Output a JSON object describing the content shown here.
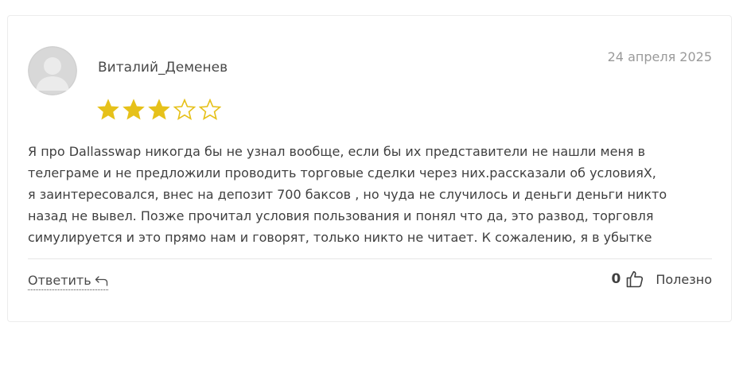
{
  "review": {
    "author": "Виталий_Деменев",
    "date": "24 апреля 2025",
    "rating": 3,
    "rating_max": 5,
    "avatar_icon": "user-avatar-placeholder-icon",
    "text_lines": [
      "Я про Dallasswap никогда бы не узнал вообще, если бы их представители не нашли меня в",
      "телеграме и не предложили проводить торговые сделки через них.рассказали об условияХ,",
      "я заинтересовался, внес на депозит 700 баксов , но чуда не случилось и деньги деньги никто",
      "назад не вывел. Позже прочитал условия пользования и понял что да, это развод, торговля",
      "симулируется и это прямо нам и говорят, только никто не читает. К сожалению, я в убытке"
    ]
  },
  "actions": {
    "reply_label": "Ответить",
    "reply_icon": "reply-arrow-icon",
    "like_count": "0",
    "like_icon": "thumbs-up-icon",
    "helpful_label": "Полезно"
  },
  "colors": {
    "star_filled": "#e6c11a",
    "star_empty_stroke": "#e6c11a",
    "text": "#3f3f3f",
    "muted": "#9a9a9a"
  }
}
